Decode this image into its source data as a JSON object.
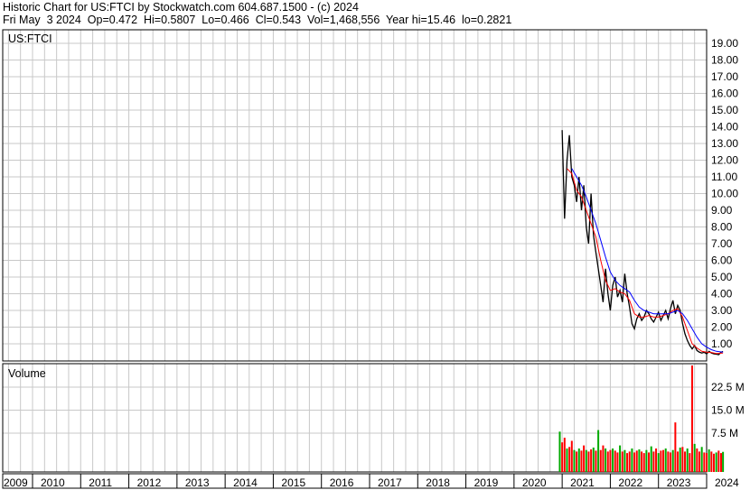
{
  "header": {
    "line1": "Historic Chart for US:FTCI by Stockwatch.com 604.687.1500 - (c) 2024",
    "line2": "Fri May  3 2024  Op=0.472  Hi=0.5807  Lo=0.466  Cl=0.543  Vol=1,468,556  Year hi=15.46  lo=0.2821"
  },
  "chart_data": [
    {
      "type": "line",
      "title": "US:FTCI",
      "ylim": [
        0,
        20
      ],
      "y_ticks": [
        "1.00",
        "2.00",
        "3.00",
        "4.00",
        "5.00",
        "6.00",
        "7.00",
        "8.00",
        "9.00",
        "10.00",
        "11.00",
        "12.00",
        "13.00",
        "14.00",
        "15.00",
        "16.00",
        "17.00",
        "18.00",
        "19.00"
      ],
      "x_ticks": [
        "2009",
        "2010",
        "2011",
        "2012",
        "2013",
        "2014",
        "2015",
        "2016",
        "2017",
        "2018",
        "2019",
        "2020",
        "2021",
        "2022",
        "2023",
        "2024"
      ],
      "xlim": [
        2009.0,
        2024.4
      ],
      "grid": true,
      "series": [
        {
          "color": "#000000",
          "x": [
            2021.0,
            2021.05,
            2021.1,
            2021.15,
            2021.2,
            2021.25,
            2021.3,
            2021.35,
            2021.4,
            2021.45,
            2021.5,
            2021.55,
            2021.6,
            2021.65,
            2021.7,
            2021.75,
            2021.8,
            2021.85,
            2021.9,
            2021.95,
            2022.0,
            2022.05,
            2022.1,
            2022.15,
            2022.2,
            2022.25,
            2022.3,
            2022.35,
            2022.4,
            2022.45,
            2022.5,
            2022.55,
            2022.6,
            2022.65,
            2022.7,
            2022.75,
            2022.8,
            2022.85,
            2022.9,
            2022.95,
            2023.0,
            2023.05,
            2023.1,
            2023.15,
            2023.2,
            2023.25,
            2023.3,
            2023.35,
            2023.4,
            2023.45,
            2023.5,
            2023.55,
            2023.6,
            2023.65,
            2023.7,
            2023.75,
            2023.8,
            2023.85,
            2023.9,
            2023.95,
            2024.0,
            2024.05,
            2024.1,
            2024.15,
            2024.2,
            2024.25,
            2024.3,
            2024.34
          ],
          "y": [
            13.8,
            8.5,
            12.0,
            13.5,
            11.0,
            10.5,
            9.5,
            11.0,
            9.0,
            10.5,
            8.0,
            7.0,
            10.0,
            7.5,
            6.5,
            5.5,
            4.5,
            3.5,
            5.5,
            4.0,
            3.0,
            4.5,
            5.0,
            3.8,
            4.2,
            3.5,
            5.2,
            4.0,
            3.2,
            2.2,
            1.9,
            2.5,
            2.8,
            2.4,
            2.6,
            3.0,
            2.8,
            2.5,
            2.3,
            2.6,
            2.9,
            2.4,
            2.7,
            3.0,
            2.5,
            3.1,
            3.6,
            2.8,
            3.3,
            3.0,
            2.2,
            1.6,
            1.2,
            0.9,
            0.7,
            0.9,
            0.6,
            0.5,
            0.45,
            0.5,
            0.4,
            0.55,
            0.45,
            0.4,
            0.38,
            0.35,
            0.5,
            0.543
          ]
        },
        {
          "color": "#ff0000",
          "x": [
            2021.1,
            2021.2,
            2021.3,
            2021.4,
            2021.5,
            2021.6,
            2021.7,
            2021.8,
            2021.9,
            2022.0,
            2022.1,
            2022.2,
            2022.3,
            2022.4,
            2022.5,
            2022.6,
            2022.7,
            2022.8,
            2022.9,
            2023.0,
            2023.1,
            2023.2,
            2023.3,
            2023.4,
            2023.5,
            2023.6,
            2023.7,
            2023.8,
            2023.9,
            2024.0,
            2024.1,
            2024.2,
            2024.34
          ],
          "y": [
            11.5,
            11.2,
            10.2,
            9.8,
            9.0,
            8.2,
            7.4,
            6.0,
            4.8,
            4.2,
            4.3,
            4.1,
            4.0,
            3.6,
            2.8,
            2.6,
            2.6,
            2.7,
            2.6,
            2.6,
            2.7,
            2.8,
            3.0,
            3.1,
            2.6,
            1.8,
            1.0,
            0.75,
            0.55,
            0.5,
            0.48,
            0.42,
            0.45
          ]
        },
        {
          "color": "#0000ff",
          "x": [
            2021.2,
            2021.3,
            2021.4,
            2021.5,
            2021.6,
            2021.7,
            2021.8,
            2021.9,
            2022.0,
            2022.1,
            2022.2,
            2022.3,
            2022.4,
            2022.5,
            2022.6,
            2022.7,
            2022.8,
            2022.9,
            2023.0,
            2023.1,
            2023.2,
            2023.3,
            2023.4,
            2023.5,
            2023.6,
            2023.7,
            2023.8,
            2023.9,
            2024.0,
            2024.1,
            2024.2,
            2024.34
          ],
          "y": [
            11.5,
            11.0,
            10.5,
            9.8,
            9.0,
            8.2,
            7.2,
            6.2,
            5.3,
            4.8,
            4.5,
            4.3,
            4.1,
            3.6,
            3.2,
            3.0,
            2.9,
            2.8,
            2.8,
            2.8,
            2.8,
            2.9,
            3.0,
            2.8,
            2.4,
            1.9,
            1.4,
            1.0,
            0.8,
            0.65,
            0.55,
            0.5
          ]
        }
      ]
    },
    {
      "type": "bar",
      "title": "Volume",
      "y_ticks": [
        "7.5 M",
        "15.0 M",
        "22.5 M"
      ],
      "ylim": [
        0,
        30
      ],
      "x": [
        2020.95,
        2021.0,
        2021.05,
        2021.1,
        2021.15,
        2021.2,
        2021.25,
        2021.3,
        2021.35,
        2021.4,
        2021.45,
        2021.5,
        2021.55,
        2021.6,
        2021.65,
        2021.7,
        2021.75,
        2021.8,
        2021.85,
        2021.9,
        2021.95,
        2022.0,
        2022.05,
        2022.1,
        2022.15,
        2022.2,
        2022.25,
        2022.3,
        2022.35,
        2022.4,
        2022.45,
        2022.5,
        2022.55,
        2022.6,
        2022.65,
        2022.7,
        2022.75,
        2022.8,
        2022.85,
        2022.9,
        2022.95,
        2023.0,
        2023.05,
        2023.1,
        2023.15,
        2023.2,
        2023.25,
        2023.3,
        2023.35,
        2023.4,
        2023.45,
        2023.5,
        2023.55,
        2023.6,
        2023.65,
        2023.7,
        2023.75,
        2023.8,
        2023.85,
        2023.9,
        2023.95,
        2024.0,
        2024.05,
        2024.1,
        2024.15,
        2024.2,
        2024.25,
        2024.3,
        2024.34
      ],
      "values": [
        8.0,
        4.5,
        6.0,
        2.5,
        3.0,
        5.0,
        2.0,
        1.5,
        2.5,
        1.8,
        3.5,
        2.0,
        1.5,
        2.2,
        2.8,
        1.8,
        8.5,
        2.0,
        3.5,
        2.5,
        1.5,
        2.0,
        2.5,
        1.8,
        1.2,
        3.5,
        1.5,
        2.0,
        1.0,
        1.5,
        2.5,
        1.2,
        1.8,
        2.2,
        1.5,
        1.0,
        2.0,
        1.2,
        3.2,
        1.5,
        2.5,
        1.0,
        1.8,
        2.0,
        2.5,
        1.5,
        1.2,
        2.0,
        11.0,
        1.5,
        2.8,
        3.0,
        1.5,
        2.5,
        1.0,
        31.0,
        4.0,
        2.5,
        1.5,
        3.0,
        1.2,
        1.0,
        2.2,
        1.5,
        0.8,
        1.2,
        1.8,
        1.0,
        1.4
      ],
      "colors": [
        "#00aa00",
        "#ff0000",
        "#ff0000",
        "#00aa00",
        "#ff0000",
        "#ff0000",
        "#00aa00",
        "#ff0000",
        "#00aa00",
        "#ff0000",
        "#ff0000",
        "#00aa00",
        "#ff0000",
        "#ff0000",
        "#00aa00",
        "#ff0000",
        "#00aa00",
        "#ff0000",
        "#ff0000",
        "#00aa00",
        "#ff0000",
        "#ff0000",
        "#00aa00",
        "#ff0000",
        "#ff0000",
        "#00aa00",
        "#ff0000",
        "#00aa00",
        "#ff0000",
        "#ff0000",
        "#00aa00",
        "#ff0000",
        "#ff0000",
        "#00aa00",
        "#ff0000",
        "#ff0000",
        "#00aa00",
        "#ff0000",
        "#00aa00",
        "#ff0000",
        "#ff0000",
        "#00aa00",
        "#ff0000",
        "#ff0000",
        "#00aa00",
        "#ff0000",
        "#ff0000",
        "#00aa00",
        "#ff0000",
        "#ff0000",
        "#00aa00",
        "#ff0000",
        "#ff0000",
        "#00aa00",
        "#ff0000",
        "#ff0000",
        "#00aa00",
        "#ff0000",
        "#ff0000",
        "#00aa00",
        "#ff0000",
        "#ff0000",
        "#00aa00",
        "#ff0000",
        "#ff0000",
        "#00aa00",
        "#ff0000",
        "#ff0000",
        "#00aa00"
      ]
    }
  ],
  "colors": {
    "grid": "#c8c8c8",
    "frame": "#000000",
    "background": "#ffffff"
  }
}
